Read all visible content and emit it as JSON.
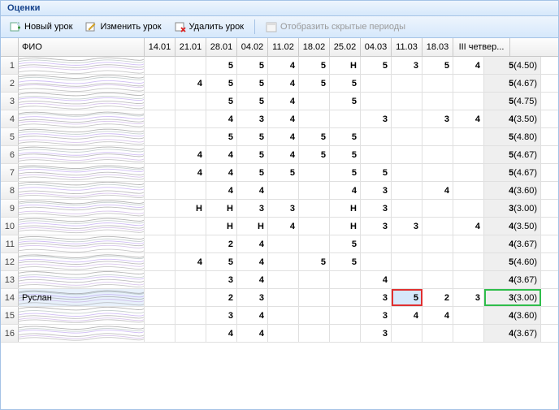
{
  "title": "Оценки",
  "toolbar": {
    "new": "Новый урок",
    "edit": "Изменить урок",
    "delete": "Удалить урок",
    "show_hidden": "Отобразить скрытые периоды"
  },
  "columns": {
    "row_num": "",
    "name": "ФИО",
    "dates": [
      "14.01",
      "21.01",
      "28.01",
      "04.02",
      "11.02",
      "18.02",
      "25.02",
      "04.03",
      "11.03",
      "18.03"
    ],
    "avg": "III четвер..."
  },
  "rows": [
    {
      "n": "1",
      "name": "",
      "marks": [
        "",
        "",
        "5",
        "5",
        "4",
        "5",
        "Н",
        "5",
        "3",
        "5",
        "4"
      ],
      "avg_g": "5",
      "avg_v": "(4.50)"
    },
    {
      "n": "2",
      "name": "",
      "marks": [
        "",
        "4",
        "5",
        "5",
        "4",
        "5",
        "5",
        "",
        "",
        "",
        ""
      ],
      "avg_g": "5",
      "avg_v": "(4.67)"
    },
    {
      "n": "3",
      "name": "",
      "marks": [
        "",
        "",
        "5",
        "5",
        "4",
        "",
        "5",
        "",
        "",
        "",
        ""
      ],
      "avg_g": "5",
      "avg_v": "(4.75)"
    },
    {
      "n": "4",
      "name": "",
      "marks": [
        "",
        "",
        "4",
        "3",
        "4",
        "",
        "",
        "3",
        "",
        "3",
        "4"
      ],
      "avg_g": "4",
      "avg_v": "(3.50)"
    },
    {
      "n": "5",
      "name": "",
      "marks": [
        "",
        "",
        "5",
        "5",
        "4",
        "5",
        "5",
        "",
        "",
        "",
        ""
      ],
      "avg_g": "5",
      "avg_v": "(4.80)"
    },
    {
      "n": "6",
      "name": "",
      "marks": [
        "",
        "4",
        "4",
        "5",
        "4",
        "5",
        "5",
        "",
        "",
        "",
        ""
      ],
      "avg_g": "5",
      "avg_v": "(4.67)"
    },
    {
      "n": "7",
      "name": "",
      "marks": [
        "",
        "4",
        "4",
        "5",
        "5",
        "",
        "5",
        "5",
        "",
        "",
        ""
      ],
      "avg_g": "5",
      "avg_v": "(4.67)"
    },
    {
      "n": "8",
      "name": "",
      "marks": [
        "",
        "",
        "4",
        "4",
        "",
        "",
        "4",
        "3",
        "",
        "4",
        ""
      ],
      "avg_g": "4",
      "avg_v": "(3.60)"
    },
    {
      "n": "9",
      "name": "",
      "marks": [
        "",
        "Н",
        "Н",
        "3",
        "3",
        "",
        "Н",
        "3",
        "",
        "",
        ""
      ],
      "avg_g": "3",
      "avg_v": "(3.00)"
    },
    {
      "n": "10",
      "name": "",
      "marks": [
        "",
        "",
        "Н",
        "Н",
        "4",
        "",
        "Н",
        "3",
        "3",
        "",
        "4"
      ],
      "avg_g": "4",
      "avg_v": "(3.50)"
    },
    {
      "n": "11",
      "name": "",
      "marks": [
        "",
        "",
        "2",
        "4",
        "",
        "",
        "5",
        "",
        "",
        "",
        ""
      ],
      "avg_g": "4",
      "avg_v": "(3.67)"
    },
    {
      "n": "12",
      "name": "",
      "marks": [
        "",
        "4",
        "5",
        "4",
        "",
        "5",
        "5",
        "",
        "",
        "",
        ""
      ],
      "avg_g": "5",
      "avg_v": "(4.60)"
    },
    {
      "n": "13",
      "name": "",
      "marks": [
        "",
        "",
        "3",
        "4",
        "",
        "",
        "",
        "4",
        "",
        "",
        ""
      ],
      "avg_g": "4",
      "avg_v": "(3.67)"
    },
    {
      "n": "14",
      "name": "Руслан",
      "marks": [
        "",
        "",
        "2",
        "3",
        "",
        "",
        "",
        "3",
        "5",
        "2",
        "3"
      ],
      "avg_g": "3",
      "avg_v": "(3.00)",
      "sel": true,
      "hl_red": 8,
      "hl_green": "avg"
    },
    {
      "n": "15",
      "name": "",
      "marks": [
        "",
        "",
        "3",
        "4",
        "",
        "",
        "",
        "3",
        "4",
        "4",
        ""
      ],
      "avg_g": "4",
      "avg_v": "(3.60)"
    },
    {
      "n": "16",
      "name": "",
      "marks": [
        "",
        "",
        "4",
        "4",
        "",
        "",
        "",
        "3",
        "",
        "",
        ""
      ],
      "avg_g": "4",
      "avg_v": "(3.67)"
    }
  ]
}
